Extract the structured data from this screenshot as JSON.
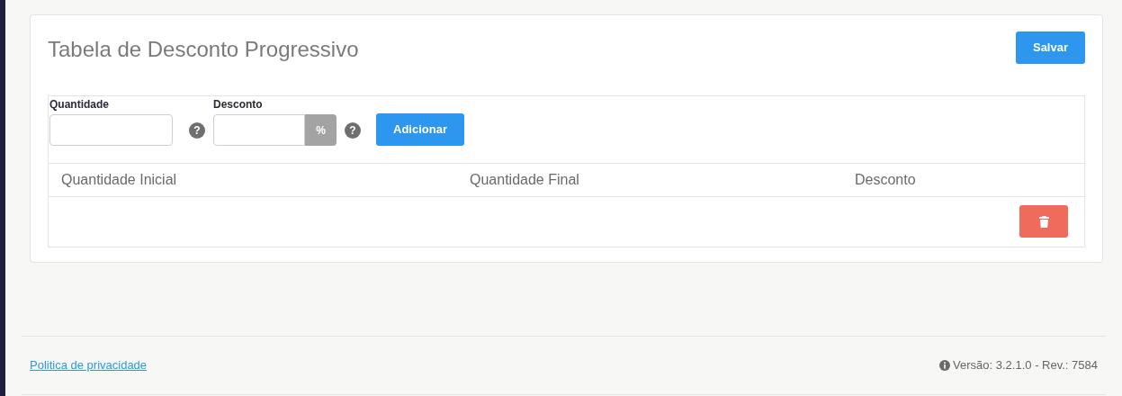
{
  "title": "Tabela de Desconto Progressivo",
  "save_button": "Salvar",
  "form": {
    "fields": [
      {
        "label": "Quantidade",
        "help": "?"
      },
      {
        "label": "Desconto",
        "suffix": "%",
        "help": "?"
      }
    ],
    "add_button": "Adicionar"
  },
  "table": {
    "columns": [
      "Quantidade Inicial",
      "Quantidade Final",
      "Desconto"
    ],
    "rows": [
      {
        "actions": [
          {
            "kind": "delete"
          }
        ]
      }
    ]
  },
  "footer": {
    "link": "Politica de privacidade",
    "version": "Versão: 3.2.1.0 - Rev.: 7584"
  }
}
